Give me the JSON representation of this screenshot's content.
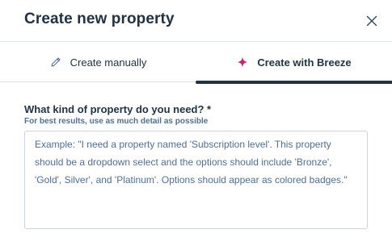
{
  "dialog": {
    "title": "Create new property",
    "close_icon": "close-icon"
  },
  "tabs": [
    {
      "label": "Create manually",
      "icon": "pencil-icon",
      "active": false
    },
    {
      "label": "Create with Breeze",
      "icon": "sparkle-icon",
      "active": true
    }
  ],
  "field": {
    "label": "What kind of property do you need? *",
    "help": "For best results, use as much detail as possible",
    "value": "",
    "placeholder": "Example: \"I need a property named 'Subscription level'. This property should be a dropdown select and the options should include 'Bronze', 'Gold', Silver', and 'Platinum'. Options should appear as colored badges.\""
  },
  "colors": {
    "title": "#213343",
    "border": "#dfe3eb",
    "active_tab_underline": "#213343",
    "breeze_sparkle": "#c7276f",
    "help_text": "#516f90"
  }
}
